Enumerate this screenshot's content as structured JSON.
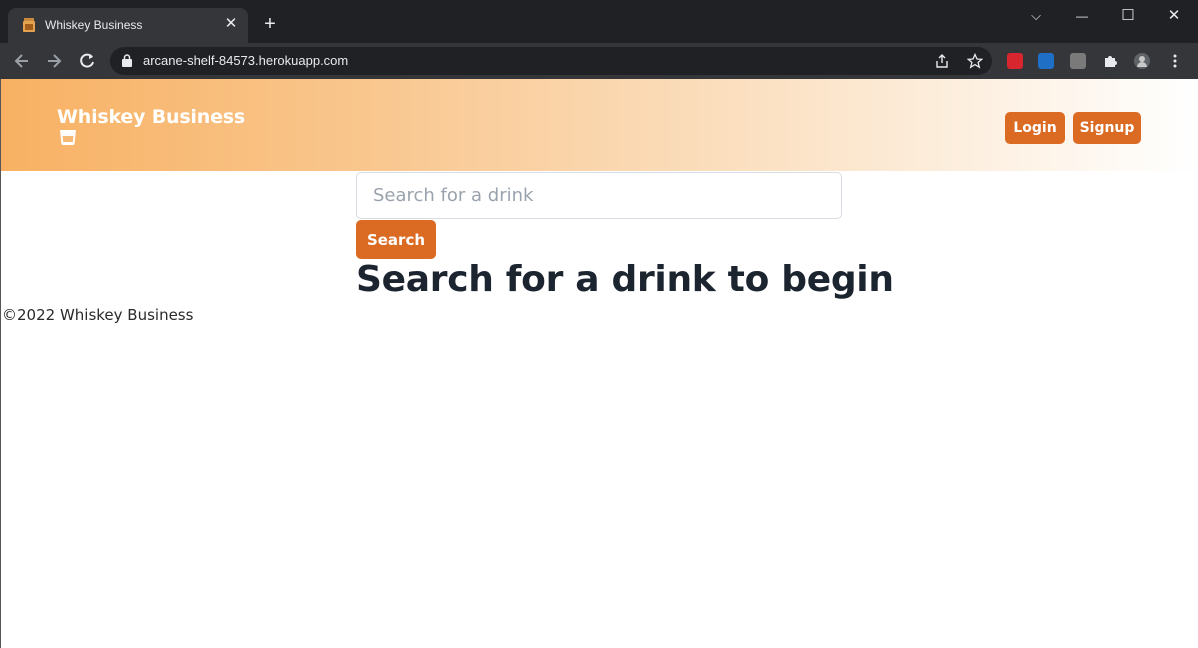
{
  "browser": {
    "tab_title": "Whiskey Business",
    "tab_close": "✕",
    "new_tab": "+",
    "url": "arcane-shelf-84573.herokuapp.com",
    "window_controls": {
      "dropdown": "⌵",
      "minimize": "—",
      "maximize": "☐",
      "close": "✕"
    }
  },
  "header": {
    "brand": "Whiskey Business",
    "brand_icon": "whiskey-glass-icon",
    "login_label": "Login",
    "signup_label": "Signup"
  },
  "search": {
    "placeholder": "Search for a drink",
    "button_label": "Search"
  },
  "main": {
    "heading": "Search for a drink to begin"
  },
  "footer": {
    "text": "©2022 Whiskey Business"
  },
  "colors": {
    "accent": "#db6a23",
    "header_gradient_start": "#f8b163",
    "heading_text": "#1c2430"
  }
}
